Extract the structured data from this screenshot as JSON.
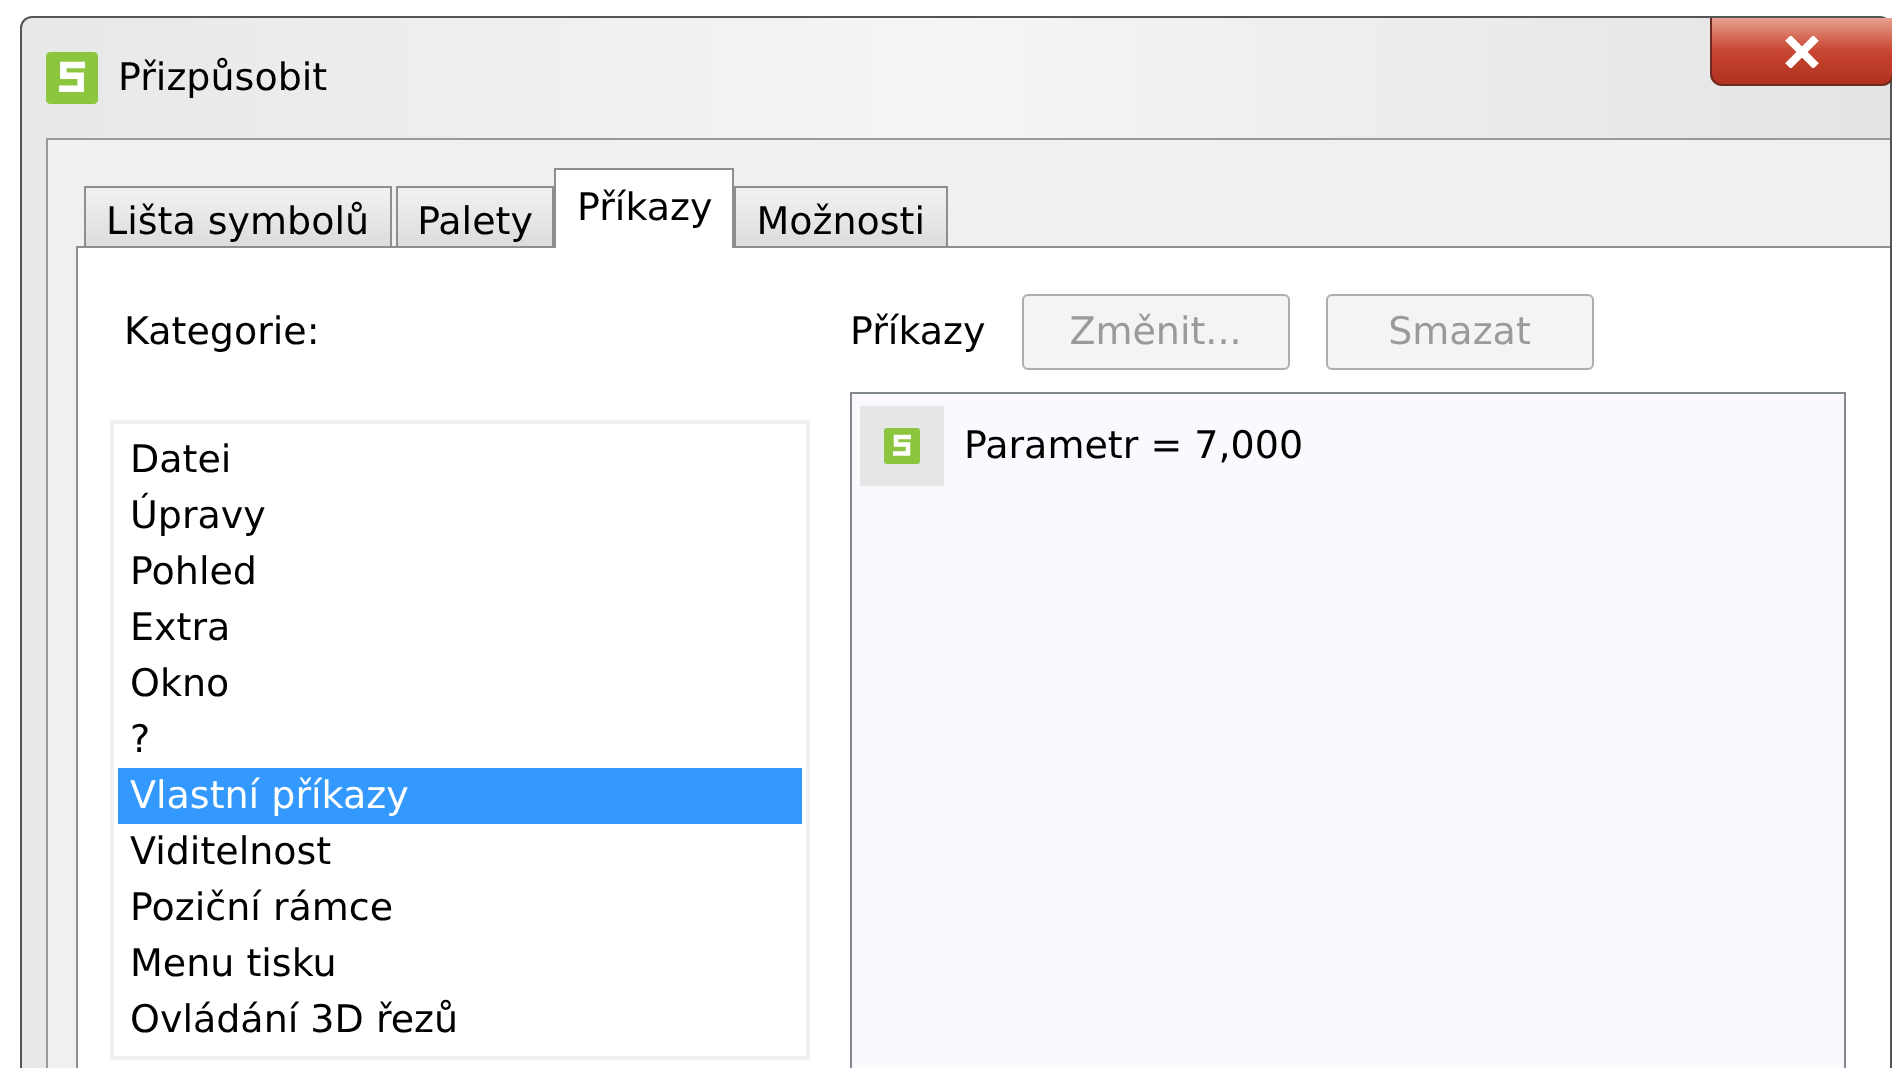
{
  "window": {
    "title": "Přizpůsobit"
  },
  "tabs": [
    {
      "label": "Lišta symbolů",
      "selected": false
    },
    {
      "label": "Palety",
      "selected": false
    },
    {
      "label": "Příkazy",
      "selected": true
    },
    {
      "label": "Možnosti",
      "selected": false
    }
  ],
  "categories": {
    "label": "Kategorie:",
    "items": [
      {
        "label": "Datei",
        "selected": false
      },
      {
        "label": "Úpravy",
        "selected": false
      },
      {
        "label": "Pohled",
        "selected": false
      },
      {
        "label": "Extra",
        "selected": false
      },
      {
        "label": "Okno",
        "selected": false
      },
      {
        "label": "?",
        "selected": false
      },
      {
        "label": "Vlastní příkazy",
        "selected": true
      },
      {
        "label": "Viditelnost",
        "selected": false
      },
      {
        "label": "Poziční rámce",
        "selected": false
      },
      {
        "label": "Menu tisku",
        "selected": false
      },
      {
        "label": "Ovládání 3D řezů",
        "selected": false
      }
    ]
  },
  "commands": {
    "label": "Příkazy",
    "buttons": [
      {
        "label": "Změnit...",
        "disabled": true
      },
      {
        "label": "Smazat",
        "disabled": true
      }
    ],
    "items": [
      {
        "label": "Parametr = 7,000"
      }
    ]
  }
}
